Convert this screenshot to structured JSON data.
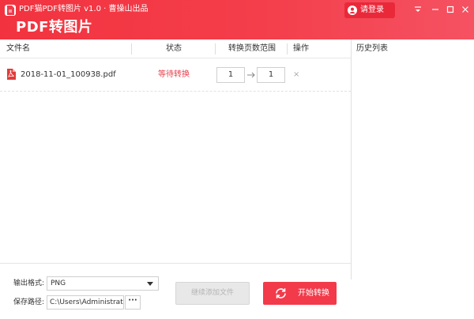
{
  "window": {
    "title": "PDF猫PDF转图片 v1.0 · 曹操山出品",
    "app_title": "PDF转图片",
    "login_label": "请登录"
  },
  "table": {
    "headers": {
      "filename": "文件名",
      "status": "状态",
      "range": "转换页数范围",
      "action": "操作"
    },
    "rows": [
      {
        "filename": "2018-11-01_100938.pdf",
        "status": "等待转换",
        "from_page": "1",
        "to_page": "1",
        "delete_symbol": "×"
      }
    ]
  },
  "history": {
    "title": "历史列表"
  },
  "settings": {
    "format_label": "输出格式:",
    "format_value": "PNG",
    "path_label": "保存路径:",
    "path_value": "C:\\Users\\Administrator",
    "browse_label": "···"
  },
  "actions": {
    "add_files_label": "继续添加文件",
    "start_label": "开始转换"
  },
  "colors": {
    "accent": "#f23a4a",
    "status": "#e8414e"
  },
  "icons": [
    "app-icon",
    "user-icon",
    "menu-down-icon",
    "minimize-icon",
    "maximize-icon",
    "close-icon",
    "pdf-file-icon",
    "arrow-right-icon",
    "refresh-icon"
  ]
}
